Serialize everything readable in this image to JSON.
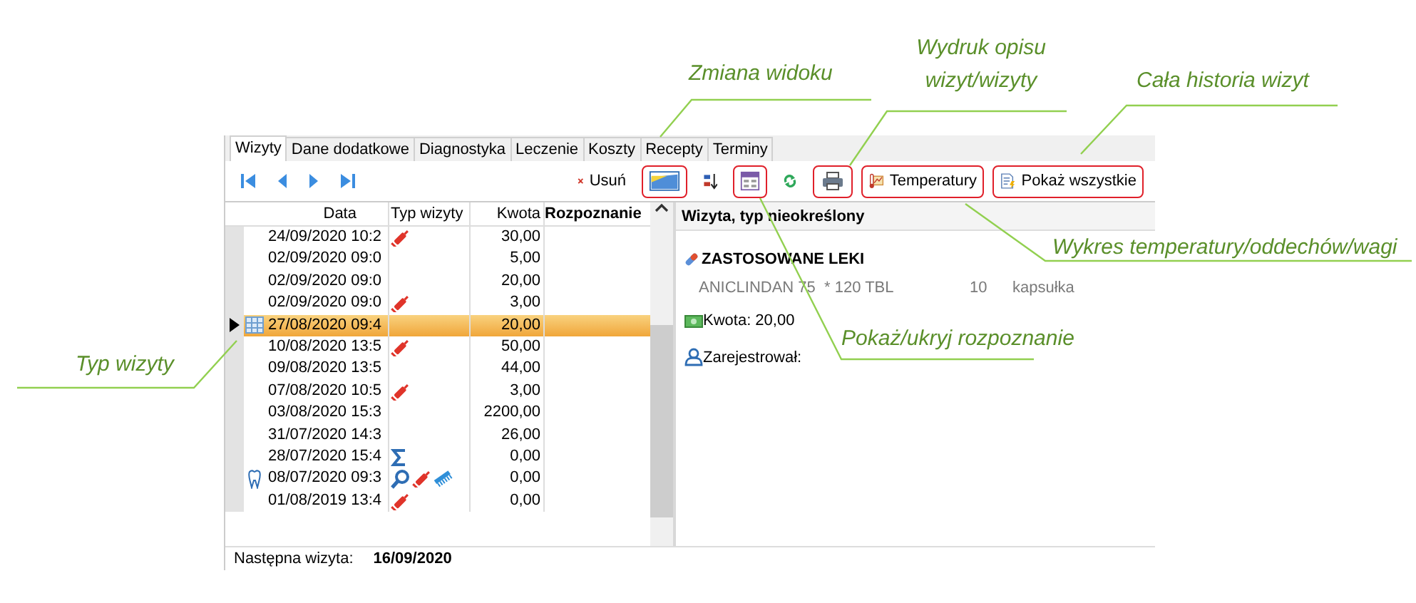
{
  "tabs": [
    {
      "label": "Wizyty",
      "selected": true
    },
    {
      "label": "Dane dodatkowe",
      "selected": false
    },
    {
      "label": "Diagnostyka",
      "selected": false
    },
    {
      "label": "Leczenie",
      "selected": false
    },
    {
      "label": "Koszty",
      "selected": false
    },
    {
      "label": "Recepty",
      "selected": false
    },
    {
      "label": "Terminy",
      "selected": false
    }
  ],
  "toolbar": [
    {
      "kind": "first",
      "highlighted": false
    },
    {
      "kind": "prev",
      "highlighted": false
    },
    {
      "kind": "next",
      "highlighted": false
    },
    {
      "kind": "last",
      "highlighted": false
    },
    {
      "kind": "delete",
      "label": "Usuń",
      "highlighted": false
    },
    {
      "kind": "view",
      "highlighted": true
    },
    {
      "kind": "sort",
      "highlighted": false
    },
    {
      "kind": "columns",
      "highlighted": true
    },
    {
      "kind": "refresh",
      "highlighted": false
    },
    {
      "kind": "print",
      "highlighted": true
    },
    {
      "kind": "temperature",
      "label": "Temperatury",
      "highlighted": true
    },
    {
      "kind": "show_all",
      "label": "Pokaż wszystkie",
      "highlighted": true
    }
  ],
  "grid": {
    "columns": [
      "Data",
      "Typ wizyty",
      "Kwota",
      "Rozpoznanie"
    ],
    "rows": [
      {
        "date": "24/09/2020 10:2",
        "types": [
          {
            "kind": "syringe"
          }
        ],
        "amount": "30,00",
        "selected": false
      },
      {
        "date": "02/09/2020 09:0",
        "amount": "5,00",
        "selected": false
      },
      {
        "date": "02/09/2020 09:0",
        "amount": "20,00",
        "selected": false
      },
      {
        "date": "02/09/2020 09:0",
        "types": [
          {
            "kind": "syringe"
          }
        ],
        "amount": "3,00",
        "selected": false
      },
      {
        "date": "27/08/2020 09:4",
        "amount": "20,00",
        "selected": true,
        "side_icon": {
          "kind": "grid"
        }
      },
      {
        "date": "10/08/2020 13:5",
        "types": [
          {
            "kind": "syringe"
          }
        ],
        "amount": "50,00",
        "selected": false
      },
      {
        "date": "09/08/2020 13:5",
        "amount": "44,00",
        "selected": false
      },
      {
        "date": "07/08/2020 10:5",
        "types": [
          {
            "kind": "syringe"
          }
        ],
        "amount": "3,00",
        "selected": false
      },
      {
        "date": "03/08/2020 15:3",
        "amount": "2200,00",
        "selected": false
      },
      {
        "date": "31/07/2020 14:3",
        "amount": "26,00",
        "selected": false
      },
      {
        "date": "28/07/2020 15:4",
        "types": [
          {
            "kind": "sigma"
          }
        ],
        "amount": "0,00",
        "selected": false
      },
      {
        "date": "08/07/2020 09:3",
        "types": [
          {
            "kind": "magnifier"
          },
          {
            "kind": "syringe"
          },
          {
            "kind": "comb"
          }
        ],
        "amount": "0,00",
        "selected": false,
        "side_icon": {
          "kind": "tooth"
        }
      },
      {
        "date": "01/08/2019 13:4",
        "types": [
          {
            "kind": "syringe"
          }
        ],
        "amount": "0,00",
        "selected": false
      }
    ]
  },
  "details": {
    "header": "Wizyta, typ nieokreślony",
    "section_title": "ZASTOSOWANE LEKI",
    "medication": {
      "name": "ANICLINDAN 75  * 120 TBL",
      "quantity": "10",
      "unit": "kapsułka"
    },
    "amount": "Kwota: 20,00",
    "registered_by": "Zarejestrował:"
  },
  "footer": {
    "label": "Następna wizyta:",
    "value": "16/09/2020"
  },
  "callouts": [
    {
      "text": "Zmiana widoku"
    },
    {
      "text": "Wydruk opisu wizyt/wizyty"
    },
    {
      "text": "Cała historia wizyt"
    },
    {
      "text": "Wykres temperatury/oddechów/wagi"
    },
    {
      "text": "Pokaż/ukryj rozpoznanie"
    },
    {
      "text": "Typ wizyty"
    }
  ]
}
